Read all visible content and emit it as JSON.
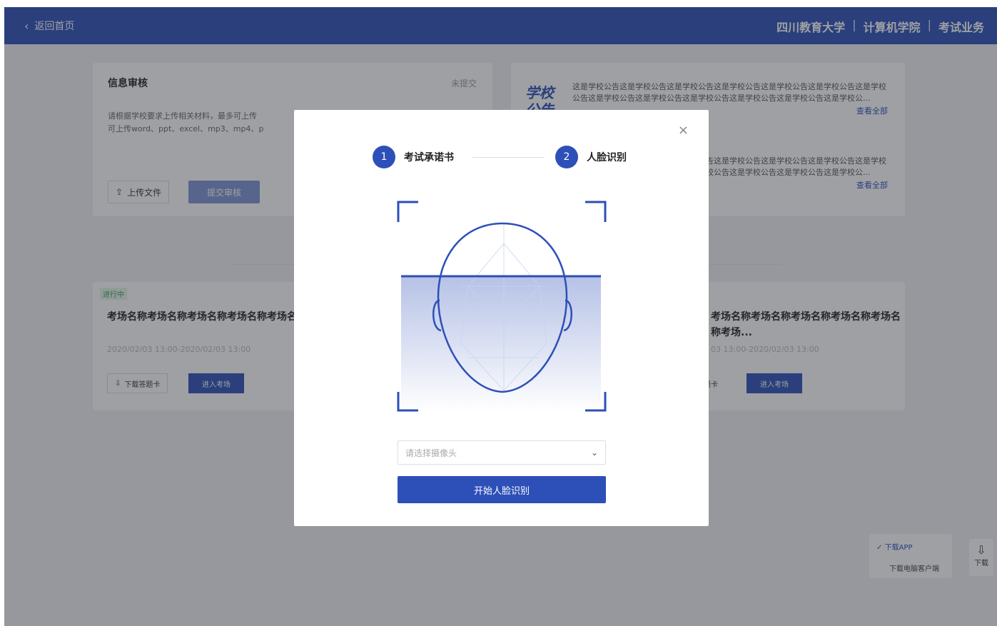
{
  "topbar": {
    "back_label": "返回首页",
    "school": "四川教育大学",
    "college": "计算机学院",
    "section": "考试业务",
    "separator": "|"
  },
  "info_card": {
    "title": "信息审核",
    "status": "未提交",
    "desc": "请根据学校要求上传相关材料，最多可上传",
    "desc2": "可上传word、ppt、excel、mp3、mp4、p",
    "upload_label": "上传文件",
    "submit_label": "提交审核"
  },
  "notice_card": {
    "big_title": "学校公告",
    "text1": "这是学校公告这是学校公告这是学校公告这是学校公告这是学校公告这是学校公告这是学校公告这是学校公告这是学校公告这是学校公告这是学校公告这是学校公告这是学校公...",
    "text2": "这是学校公告这是学校公告这是学校公告这是学校公告这是学校公告这是学校公告这是学校公告这是学校公告这是学校公告这是学校公告这是学校公告这是学校公告这是学校公...",
    "more_label": "查看全部"
  },
  "rooms": [
    {
      "tag": "进行中",
      "name": "考场名称考场名称考场名称考场名称考场名称考场名称考场名称考场...",
      "time": "2020/02/03 13:00-2020/02/03 13:00",
      "download_label": "下载答题卡",
      "enter_label": "进入考场"
    },
    {
      "name": "考场名称考场名称考场名称考场名称考场名称考场...",
      "time": "03 13:00-2020/02/03 13:00",
      "download_label": "题卡",
      "enter_label": "进入考场"
    }
  ],
  "download_widget": {
    "option_app": "下载APP",
    "option_pc": "下载电脑客户端",
    "side_label": "下载"
  },
  "modal": {
    "close_icon": "×",
    "steps": [
      {
        "num": "1",
        "label": "考试承诺书"
      },
      {
        "num": "2",
        "label": "人脸识别"
      }
    ],
    "camera_placeholder": "请选择摄像头",
    "start_label": "开始人脸识别",
    "accent_color": "#2d4fb8"
  }
}
